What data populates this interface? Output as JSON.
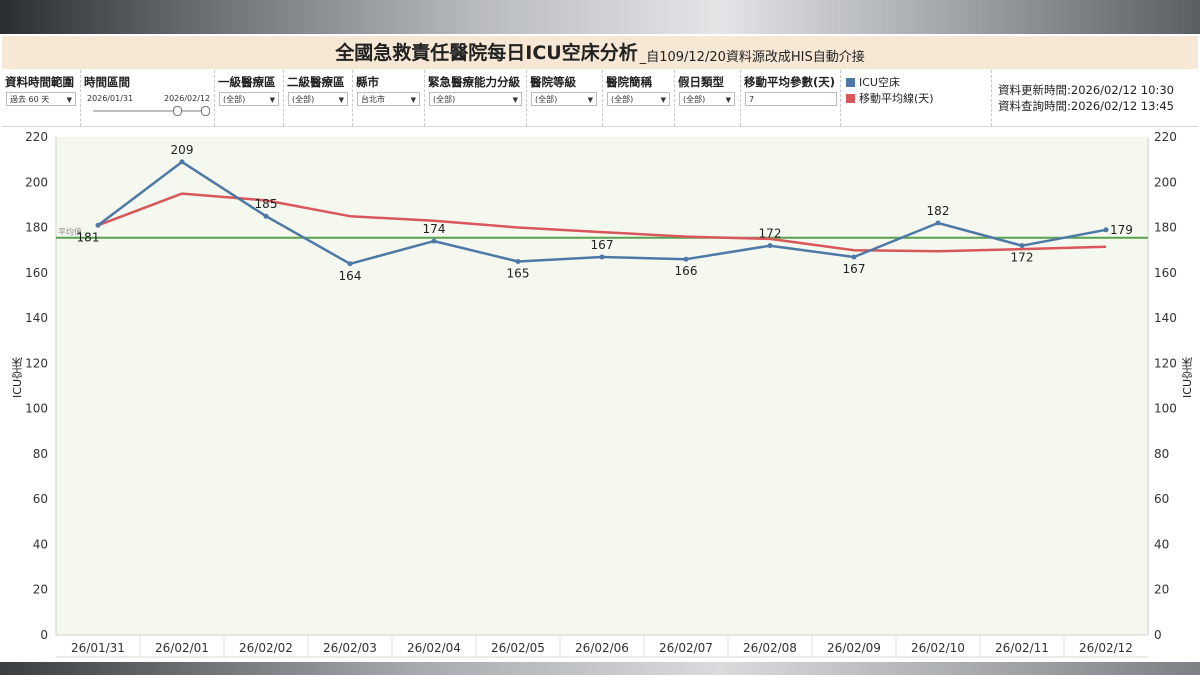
{
  "title": {
    "main": "全國急救責任醫院每日ICU空床分析",
    "sub": "_自109/12/20資料源改成HIS自動介接"
  },
  "filters": {
    "time_range_label": "資料時間範圍",
    "time_range_value": "過去 60 天",
    "interval_label": "時間區間",
    "interval_start": "2026/01/31",
    "interval_end": "2026/02/12",
    "region1_label": "一級醫療區",
    "region1_value": "(全部)",
    "region2_label": "二級醫療區",
    "region2_value": "(全部)",
    "city_label": "縣市",
    "city_value": "台北市",
    "capacity_label": "緊急醫療能力分級",
    "capacity_value": "(全部)",
    "level_label": "醫院等級",
    "level_value": "(全部)",
    "hospital_label": "醫院簡稱",
    "hospital_value": "(全部)",
    "holiday_label": "假日類型",
    "holiday_value": "(全部)",
    "ma_label": "移動平均參數(天)",
    "ma_value": "7"
  },
  "legend": {
    "icu": "ICU空床",
    "ma": "移動平均線(天)"
  },
  "info": {
    "updated": "資料更新時間:2026/02/12 10:30",
    "queried": "資料查詢時間:2026/02/12 13:45"
  },
  "colors": {
    "icu": "#4e79a7",
    "ma": "#d9575b",
    "avg": "#59a14f",
    "plot_bg": "#f4f8ef",
    "title_bg": "#f7e8d6"
  },
  "chart_data": {
    "type": "line",
    "ylabel": "ICU空床",
    "ylim": [
      0,
      220
    ],
    "yticks": [
      0,
      20,
      40,
      60,
      80,
      100,
      120,
      140,
      160,
      180,
      200,
      220
    ],
    "categories": [
      "26/01/31",
      "26/02/01",
      "26/02/02",
      "26/02/03",
      "26/02/04",
      "26/02/05",
      "26/02/06",
      "26/02/07",
      "26/02/08",
      "26/02/09",
      "26/02/10",
      "26/02/11",
      "26/02/12"
    ],
    "series": [
      {
        "name": "ICU空床",
        "values": [
          181,
          209,
          185,
          164,
          174,
          165,
          167,
          166,
          172,
          167,
          182,
          172,
          179
        ]
      },
      {
        "name": "移動平均線(天)",
        "values": [
          181,
          195,
          192,
          185,
          183,
          180,
          178,
          176,
          175,
          170,
          169.5,
          170.5,
          171.5
        ]
      }
    ],
    "average": {
      "label": "平均值",
      "value": 175.5
    },
    "dual_axis": true,
    "grid": false
  }
}
